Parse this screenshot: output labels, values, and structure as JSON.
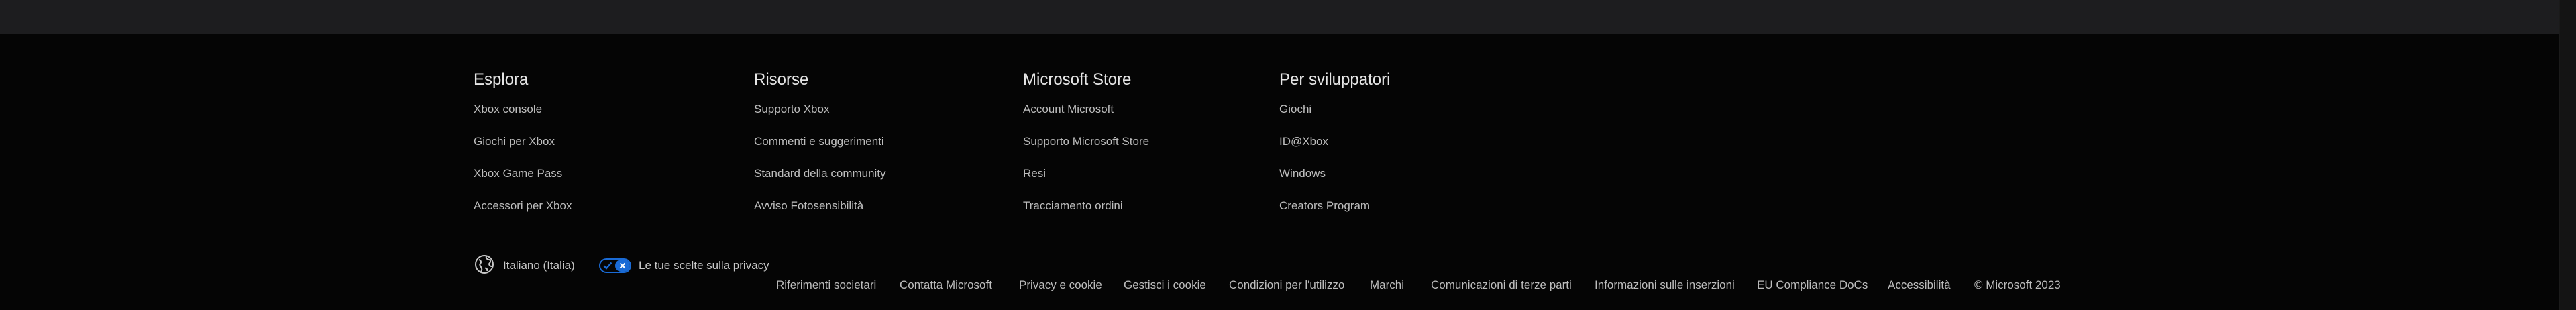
{
  "footer": {
    "columns": [
      {
        "title": "Esplora",
        "links": [
          "Xbox console",
          "Giochi per Xbox",
          "Xbox Game Pass",
          "Accessori per Xbox"
        ]
      },
      {
        "title": "Risorse",
        "links": [
          "Supporto Xbox",
          "Commenti e suggerimenti",
          "Standard della community",
          "Avviso Fotosensibilità"
        ]
      },
      {
        "title": "Microsoft Store",
        "links": [
          "Account Microsoft",
          "Supporto Microsoft Store",
          "Resi",
          "Tracciamento ordini"
        ]
      },
      {
        "title": "Per sviluppatori",
        "links": [
          "Giochi",
          "ID@Xbox",
          "Windows",
          "Creators Program"
        ]
      }
    ],
    "locale": {
      "label": "Italiano (Italia)",
      "icon": "globe-icon"
    },
    "privacy": {
      "label": "Le tue scelte sulla privacy",
      "icon": "privacy-toggle-icon",
      "accent": "#1a6bd6"
    },
    "bottom_links": [
      "Riferimenti societari",
      "Contatta Microsoft",
      "Privacy e cookie",
      "Gestisci i cookie",
      "Condizioni per l'utilizzo",
      "Marchi",
      "Comunicazioni di terze parti",
      "Informazioni sulle inserzioni",
      "EU Compliance DoCs",
      "Accessibilità",
      "© Microsoft 2023"
    ]
  }
}
